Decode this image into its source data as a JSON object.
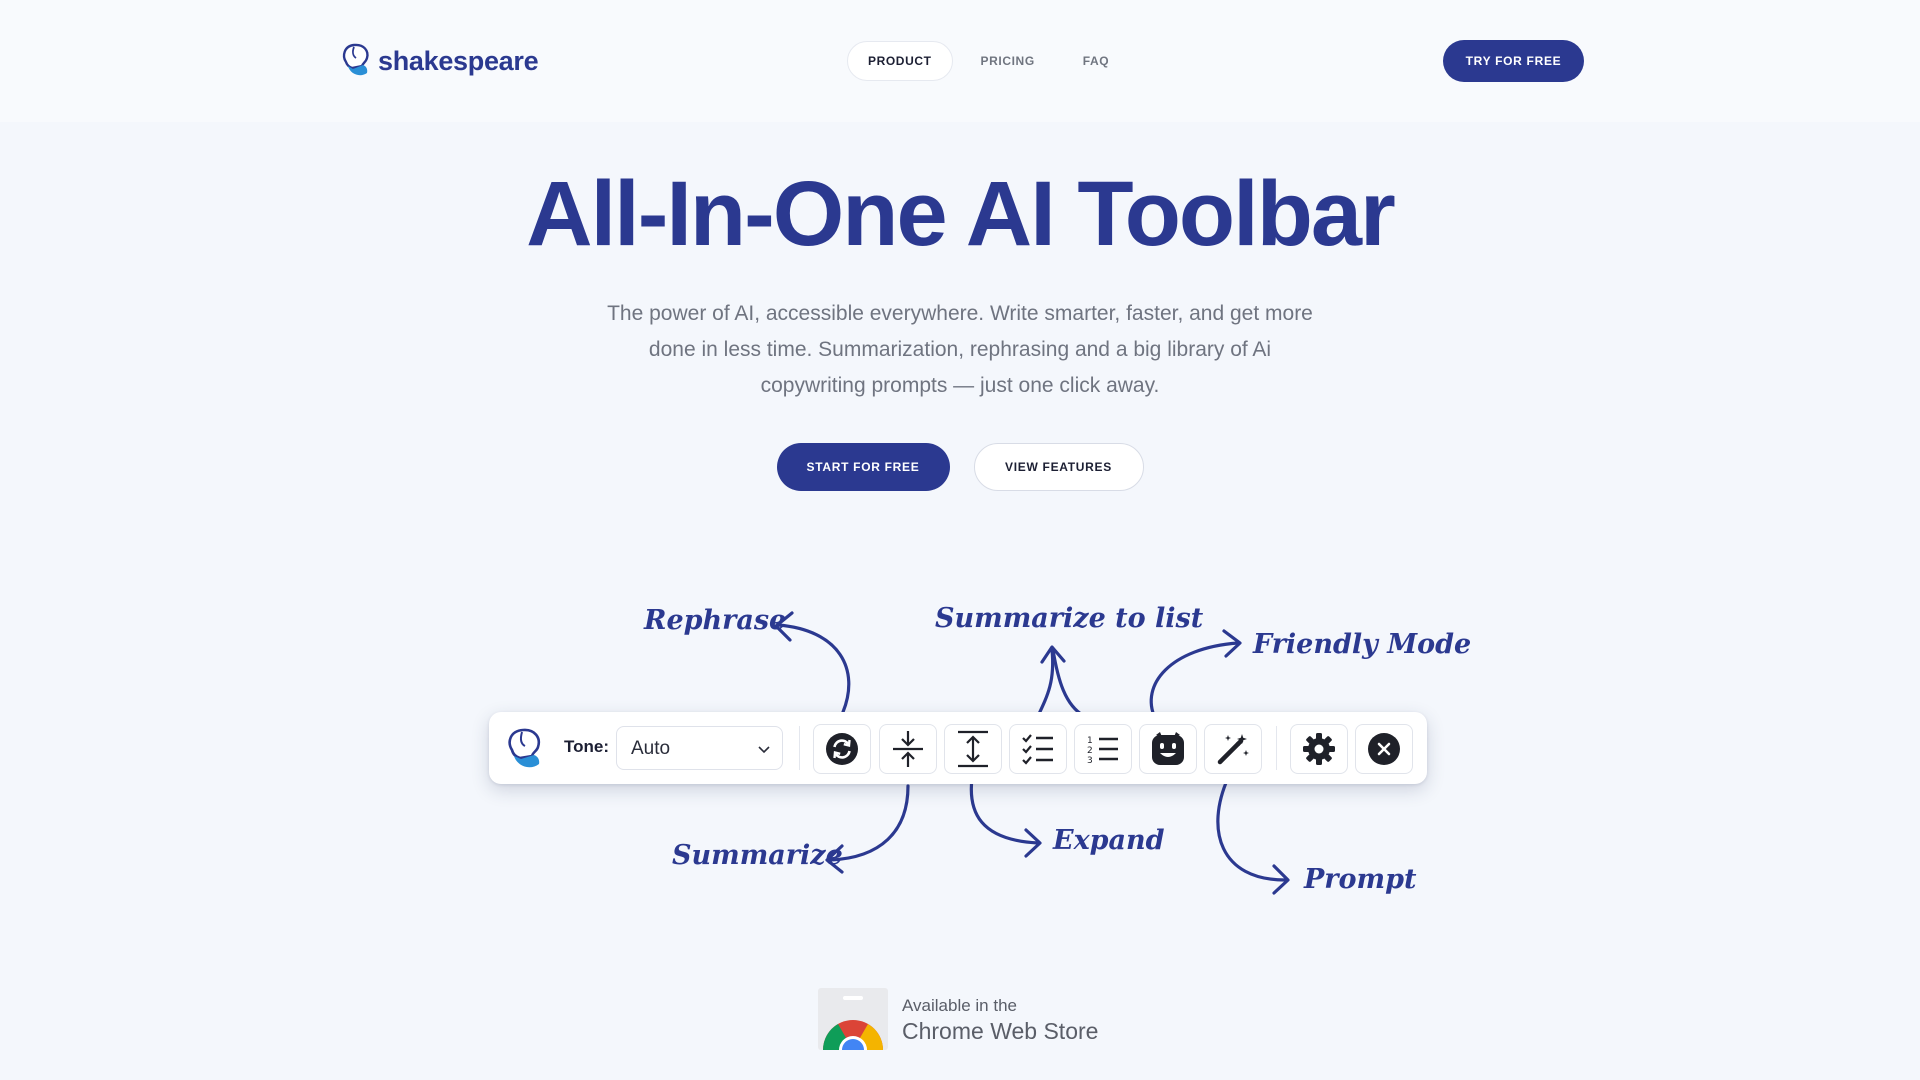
{
  "header": {
    "logo_text": "shakespeare",
    "nav": [
      {
        "label": "PRODUCT"
      },
      {
        "label": "PRICING"
      },
      {
        "label": "FAQ"
      }
    ],
    "cta_label": "TRY FOR FREE"
  },
  "hero": {
    "title": "All-In-One AI Toolbar",
    "subtitle": "The power of AI, accessible everywhere. Write smarter, faster, and get more done in less time. Summarization, rephrasing and a big library of Ai copywriting prompts — just one click away.",
    "start_label": "START FOR FREE",
    "features_label": "VIEW FEATURES"
  },
  "toolbar": {
    "tone_label": "Tone:",
    "tone_value": "Auto",
    "buttons": [
      {
        "icon": "rephrase-icon"
      },
      {
        "icon": "summarize-icon"
      },
      {
        "icon": "expand-icon"
      },
      {
        "icon": "checklist-icon"
      },
      {
        "icon": "numbered-list-icon"
      },
      {
        "icon": "friendly-face-icon"
      },
      {
        "icon": "magic-wand-icon"
      },
      {
        "icon": "gear-icon"
      },
      {
        "icon": "close-icon"
      }
    ]
  },
  "annotations": {
    "rephrase": "Rephrase",
    "summarize_list": "Summarize to list",
    "friendly": "Friendly Mode",
    "summarize": "Summarize",
    "expand": "Expand",
    "prompt": "Prompt"
  },
  "store": {
    "line1": "Available in the",
    "line2": "Chrome Web Store"
  },
  "colors": {
    "brand": "#2b3990",
    "background": "#f4f7fc",
    "muted_text": "#6f7480"
  }
}
